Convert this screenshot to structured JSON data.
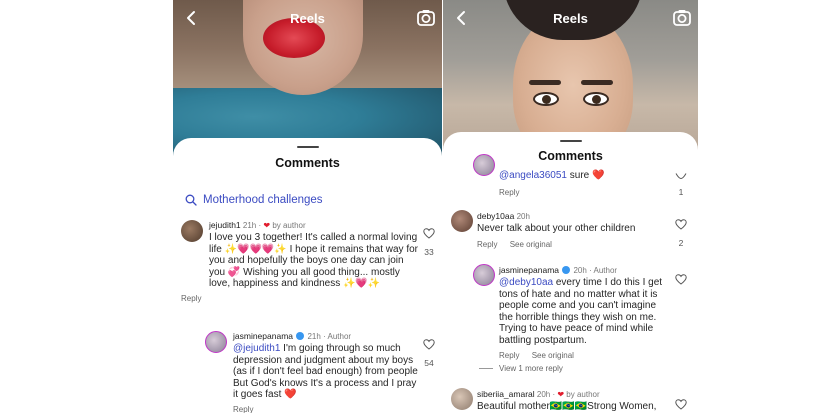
{
  "left_panel": {
    "title": "Reels",
    "comments_title": "Comments",
    "search_suggestion": "Motherhood challenges",
    "comments": [
      {
        "username": "jejudith1",
        "time": "21h",
        "by_author": "by author",
        "text": "I love you 3 together! It's called a normal loving life ✨💗💗💗✨ I hope it remains that way for you and hopefully the boys one day can join you 💞 Wishing you all good thing... mostly love, happiness and kindness ✨💗✨",
        "reply_label": "Reply",
        "likes": "33"
      },
      {
        "username": "jasminepanama",
        "time": "21h",
        "tag": "Author",
        "mention": "@jejudith1",
        "text": " I'm going through so much depression and judgment about my boys (as if I don't feel bad enough) from people But God's knows It's a process and I pray it goes fast ❤️",
        "reply_label": "Reply",
        "likes": "54"
      }
    ]
  },
  "right_panel": {
    "title": "Reels",
    "comments_title": "Comments",
    "comments": [
      {
        "mention": "@angela36051",
        "text": " sure ❤️",
        "reply_label": "Reply",
        "likes": "1"
      },
      {
        "username": "deby10aa",
        "time": "20h",
        "text": "Never talk about your other children",
        "reply_label": "Reply",
        "see_original": "See original",
        "likes": "2"
      },
      {
        "username": "jasminepanama",
        "time": "20h",
        "tag": "Author",
        "mention": "@deby10aa",
        "text": " every time I do this I get tons of hate and no matter what it is people come and you can't imagine the horrible things they wish on me. Trying to have peace of mind while battling postpartum.",
        "reply_label": "Reply",
        "see_original": "See original"
      },
      {
        "view_more": "View 1 more reply"
      },
      {
        "username": "siberiia_amaral",
        "time": "20h",
        "by_author": "by author",
        "text": "Beautiful mother🇧🇷🇧🇷🇧🇷Strong Women,"
      }
    ]
  }
}
